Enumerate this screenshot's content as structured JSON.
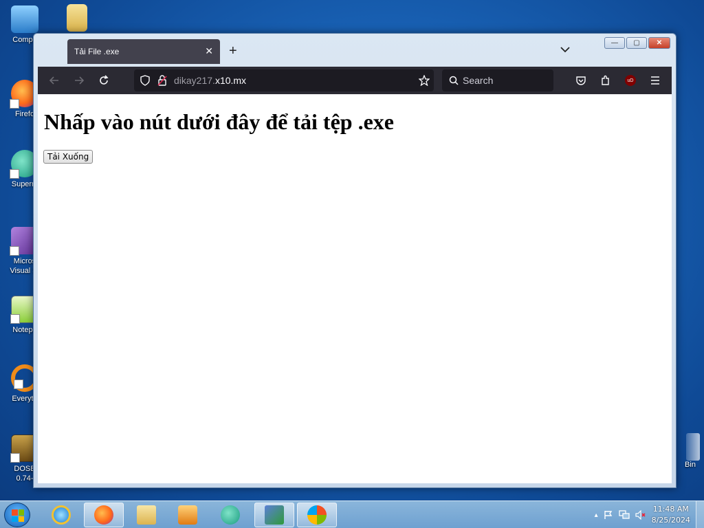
{
  "desktop": {
    "icons": [
      {
        "label": "Compu"
      },
      {
        "label": "Firefo"
      },
      {
        "label": "Superm"
      },
      {
        "label": "Micros Visual St"
      },
      {
        "label": "Notepa"
      },
      {
        "label": "Everyth"
      },
      {
        "label": "DOSB 0.74-"
      }
    ],
    "right_icon_label": "Bin"
  },
  "browser": {
    "tab": {
      "title": "Tải File .exe",
      "close_glyph": "✕"
    },
    "new_tab_glyph": "+",
    "tab_list_glyph": "⌄",
    "window_controls": {
      "minimize": "—",
      "maximize": "▢",
      "close": "✕"
    },
    "url": {
      "grey_part": "dikay217.",
      "main_part": "x10.mx"
    },
    "search": {
      "placeholder": "Search"
    },
    "ublock_label": "uD"
  },
  "page": {
    "heading": "Nhấp vào nút dưới đây để tải tệp .exe",
    "download_button": "Tải Xuống"
  },
  "taskbar": {
    "time": "11:48 AM",
    "date": "8/25/2024",
    "tray_overflow_glyph": "▴"
  }
}
